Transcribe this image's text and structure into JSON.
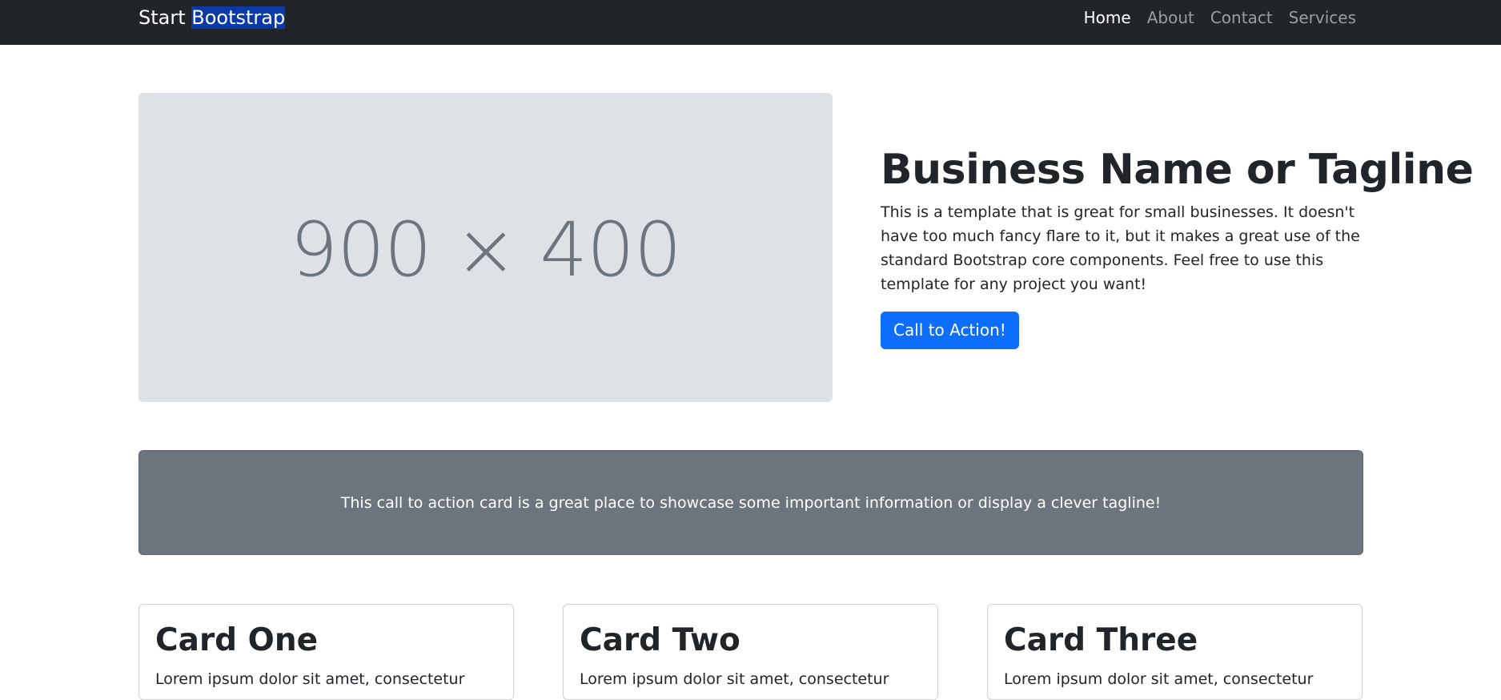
{
  "navbar": {
    "brand_part1": "Start ",
    "brand_part2": "Bootstrap",
    "links": [
      {
        "label": "Home",
        "active": true
      },
      {
        "label": "About",
        "active": false
      },
      {
        "label": "Contact",
        "active": false
      },
      {
        "label": "Services",
        "active": false
      }
    ]
  },
  "hero": {
    "image_placeholder": "900 × 400",
    "title": "Business Name or Tagline",
    "description": "This is a template that is great for small businesses. It doesn't have too much fancy flare to it, but it makes a great use of the standard Bootstrap core components. Feel free to use this template for any project you want!",
    "cta_label": "Call to Action!"
  },
  "callout": {
    "text": "This call to action card is a great place to showcase some important information or display a clever tagline!"
  },
  "cards": [
    {
      "title": "Card One",
      "text": "Lorem ipsum dolor sit amet, consectetur"
    },
    {
      "title": "Card Two",
      "text": "Lorem ipsum dolor sit amet, consectetur"
    },
    {
      "title": "Card Three",
      "text": "Lorem ipsum dolor sit amet, consectetur"
    }
  ],
  "colors": {
    "navbar_bg": "#212529",
    "primary": "#0d6efd",
    "secondary": "#6c757d",
    "placeholder_bg": "#dee2e6",
    "selection": "#0b3aa8"
  }
}
